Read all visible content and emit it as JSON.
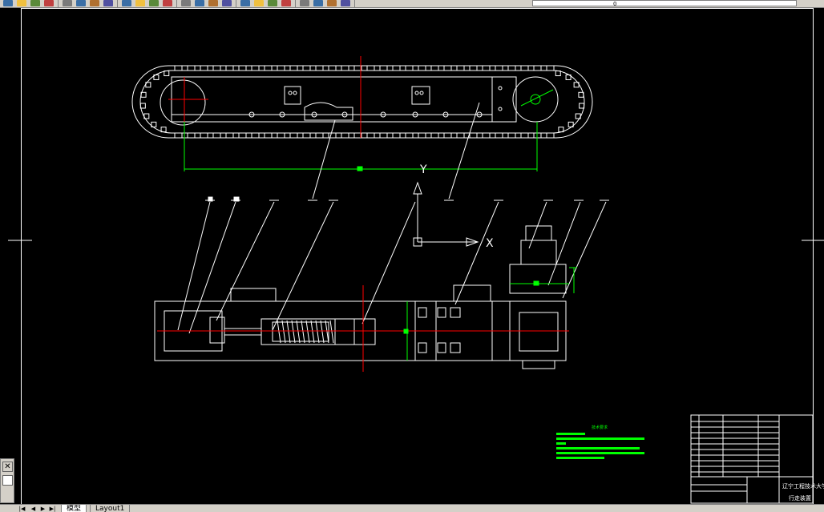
{
  "toolbar": {
    "layer_value": "0",
    "icons": [
      "new-icon",
      "open-icon",
      "save-icon",
      "print-icon",
      "preview-icon",
      "cut-icon",
      "copy-icon",
      "paste-icon",
      "match-icon",
      "undo-icon",
      "redo-icon",
      "pan-icon",
      "zoom-realtime-icon",
      "zoom-window-icon",
      "zoom-previous-icon",
      "properties-icon",
      "designcenter-icon",
      "toolpalette-icon",
      "sheetset-icon",
      "markup-icon",
      "quickcalc-icon",
      "help-icon",
      "layer-manager-icon",
      "layer-state-icon"
    ],
    "colors": {
      "bg": "#d4d0c8"
    }
  },
  "tabs": {
    "model": "模型",
    "layout1": "Layout1"
  },
  "ucs": {
    "axis_x": "X",
    "axis_y": "Y"
  },
  "drawing": {
    "tech_title": "技术要求",
    "title_block_school": "辽宁工程技术大学",
    "title_block_part": "行走装置",
    "colors": {
      "line": "#ffffff",
      "center": "#ff0000",
      "dim": "#00ff00",
      "bg": "#000000"
    }
  }
}
